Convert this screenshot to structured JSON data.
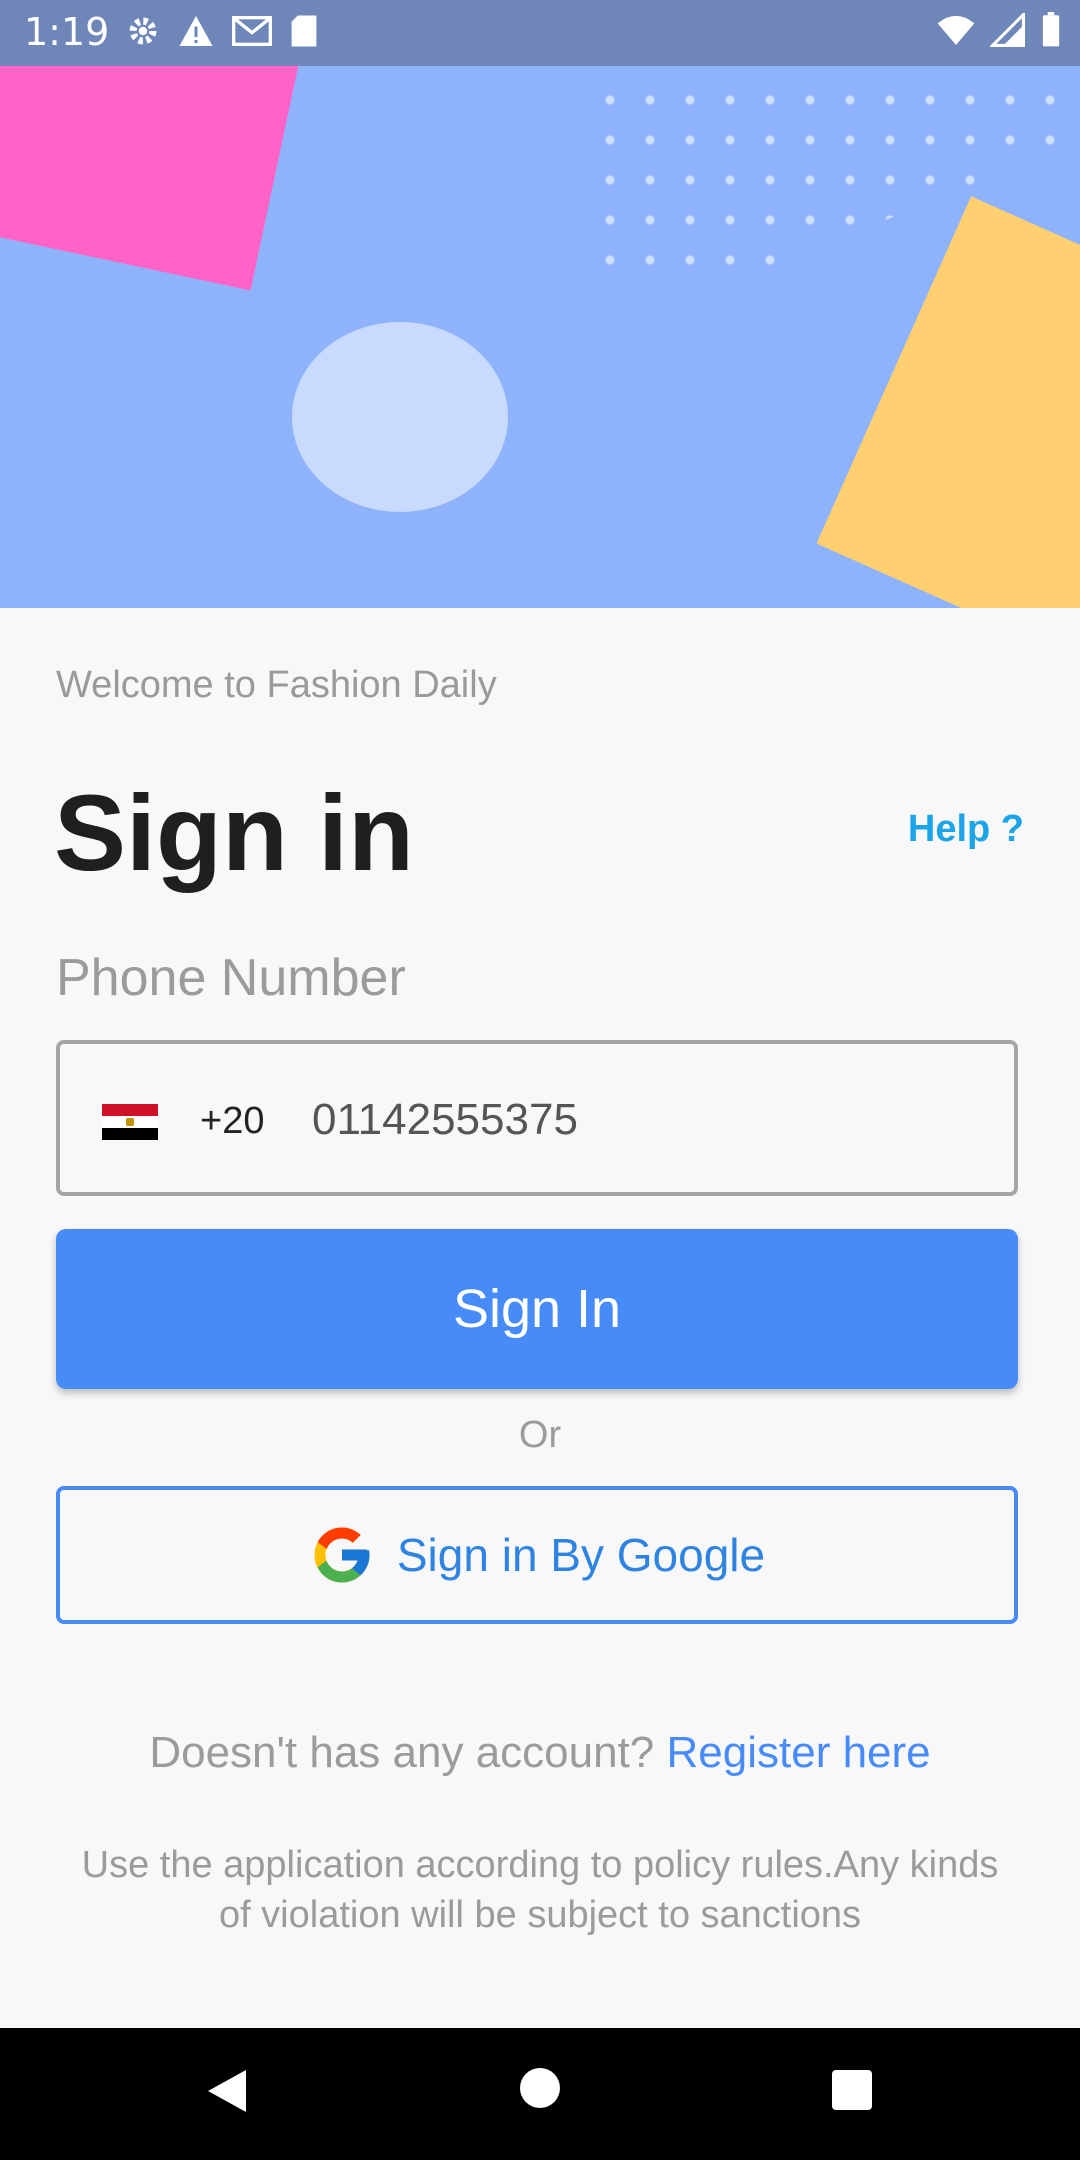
{
  "status": {
    "time": "1:19"
  },
  "welcome_text": "Welcome to Fashion Daily",
  "title": "Sign in",
  "help_link": "Help ?",
  "phone": {
    "label": "Phone Number",
    "country_code": "+20",
    "value": "01142555375",
    "flag_icon": "egypt-flag-icon"
  },
  "buttons": {
    "sign_in": "Sign In",
    "or": "Or",
    "google": "Sign in By Google"
  },
  "footer": {
    "prompt": "Doesn't has any account?",
    "register": "Register here",
    "policy": "Use the application according to policy rules.Any kinds of violation will be subject to sanctions"
  },
  "colors": {
    "accent": "#478bf8",
    "help": "#1ba4e8",
    "hero_bg": "#8fb3fb"
  }
}
